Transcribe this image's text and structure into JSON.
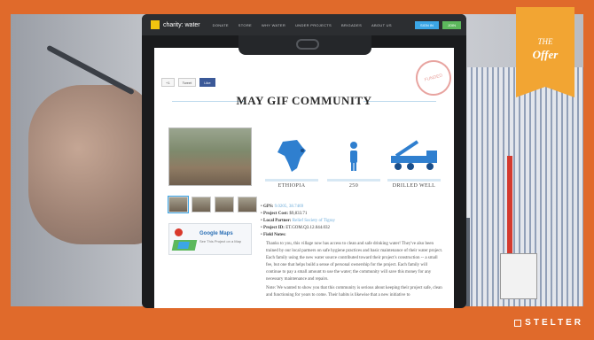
{
  "badge": {
    "line1": "THE",
    "line2": "Offer"
  },
  "brand": {
    "name": "STELTER"
  },
  "site": {
    "logo": "charity: water",
    "nav": [
      "DONATE",
      "STORE",
      "WHY WATER",
      "UNDER PROJECTS",
      "BRIGADES",
      "ABOUT US"
    ],
    "buttons": {
      "blue": "SIGN IN",
      "green": "JOIN"
    }
  },
  "page": {
    "title": "MAY GIF COMMUNITY",
    "share": {
      "tweet": "Tweet",
      "like": "Like",
      "plus": "+1"
    },
    "stamp": "FUNDED",
    "maps": {
      "title": "Google Maps",
      "subtitle": "See This Project on a Map"
    },
    "stats": [
      {
        "icon": "map-africa-icon",
        "value": "ETHIOPIA"
      },
      {
        "icon": "person-icon",
        "value": "250"
      },
      {
        "icon": "drilling-rig-icon",
        "value": "DRILLED WELL"
      }
    ],
    "details": [
      {
        "label": "GPS:",
        "value": "9.0205, 38.7469"
      },
      {
        "label": "Project Cost:",
        "value": "$9,833.71"
      },
      {
        "label": "Local Partner:",
        "value": "Relief Society of Tigray"
      },
      {
        "label": "Project ID:",
        "value": "ET.GOM.Q3.12.044.032"
      },
      {
        "label": "Field Notes:",
        "value": ""
      }
    ],
    "note1": "Thanks to you, this village now has access to clean and safe drinking water! They've also been trained by our local partners on safe hygiene practices and basic maintenance of their water project. Each family using the new water source contributed toward their project's construction -- a small fee, but one that helps build a sense of personal ownership for the project. Each family will continue to pay a small amount to use the water; the community will save this money for any necessary maintenance and repairs.",
    "note2": "Note: We wanted to show you that this community is serious about keeping their project safe, clean and functioning for years to come. Their habits is likewise that a new initiative to"
  },
  "colors": {
    "frame": "#e06a2b",
    "badge": "#f2a533",
    "accent": "#3ba6e6"
  }
}
